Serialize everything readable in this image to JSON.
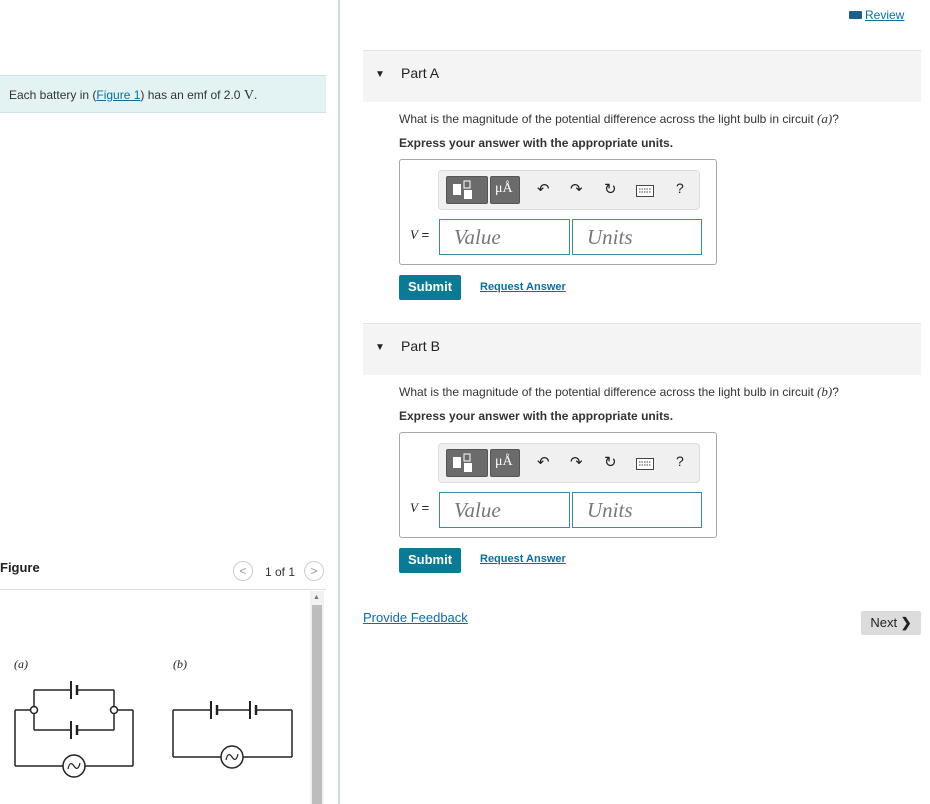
{
  "header": {
    "review_label": "Review"
  },
  "stem": {
    "prefix": "Each battery in (",
    "figure_link": "Figure 1",
    "suffix": ") has an emf of 2.0",
    "unit": "V",
    "tail": "."
  },
  "figure_panel": {
    "title": "Figure",
    "counter": "1 of 1",
    "prev_symbol": "<",
    "next_symbol": ">",
    "labels": {
      "a": "(a)",
      "b": "(b)"
    }
  },
  "parts": [
    {
      "label": "Part A",
      "question_prefix": "What is the magnitude of the potential difference across the light bulb in circuit ",
      "question_var": "(a)",
      "question_suffix": "?",
      "instruction": "Express your answer with the appropriate units.",
      "variable": "V",
      "equals": "=",
      "value_placeholder": "Value",
      "units_placeholder": "Units",
      "submit_label": "Submit",
      "request_label": "Request Answer"
    },
    {
      "label": "Part B",
      "question_prefix": "What is the magnitude of the potential difference across the light bulb in circuit ",
      "question_var": "(b)",
      "question_suffix": "?",
      "instruction": "Express your answer with the appropriate units.",
      "variable": "V",
      "equals": "=",
      "value_placeholder": "Value",
      "units_placeholder": "Units",
      "submit_label": "Submit",
      "request_label": "Request Answer"
    }
  ],
  "toolbar": {
    "units_button": "μÅ",
    "help": "?"
  },
  "footer": {
    "feedback_label": "Provide Feedback",
    "next_label": "Next"
  },
  "colors": {
    "accent": "#0b7a95",
    "stem_bg": "#e3f3f4",
    "link": "#0a6fa0"
  }
}
